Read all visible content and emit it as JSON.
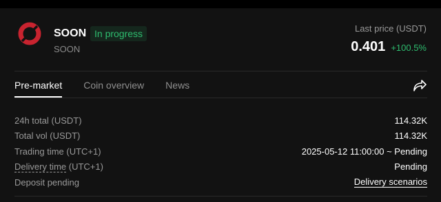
{
  "coin": {
    "name": "SOON",
    "subname": "SOON",
    "status_badge": "In progress",
    "logo_icon": "soon-logo-icon",
    "logo_color": "#c8232f"
  },
  "price": {
    "label": "Last price (USDT)",
    "value": "0.401",
    "change": "+100.5%",
    "change_color": "#2ebd6f"
  },
  "tabs": [
    {
      "label": "Pre-market",
      "active": true
    },
    {
      "label": "Coin overview",
      "active": false
    },
    {
      "label": "News",
      "active": false
    }
  ],
  "share_icon": "share-icon",
  "details": [
    {
      "label": "24h total (USDT)",
      "value": "114.32K"
    },
    {
      "label": "Total vol (USDT)",
      "value": "114.32K"
    },
    {
      "label": "Trading time (UTC+1)",
      "value": "2025-05-12 11:00:00 ~ Pending"
    },
    {
      "label_underlined": "Delivery time",
      "label_rest": " (UTC+1)",
      "value": "Pending"
    },
    {
      "label": "Deposit pending",
      "link": "Delivery scenarios"
    }
  ]
}
